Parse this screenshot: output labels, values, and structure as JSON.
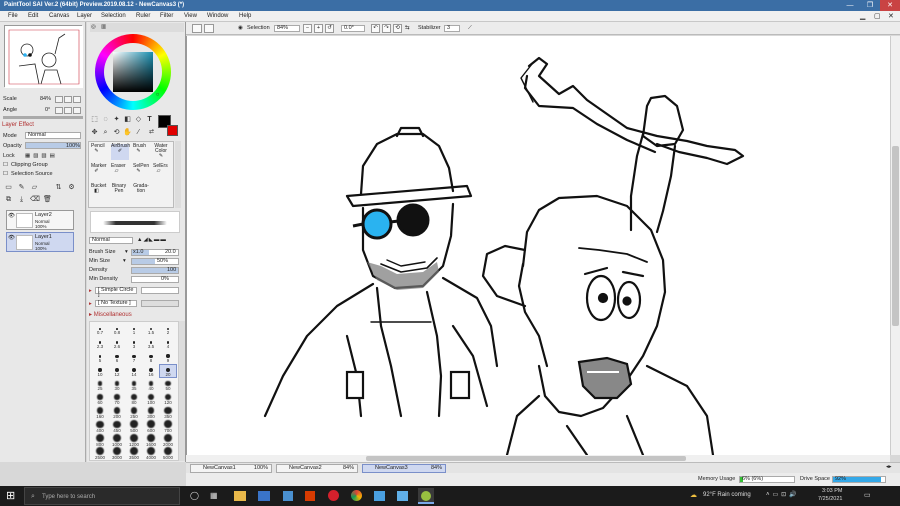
{
  "app": {
    "title": "PaintTool SAI Ver.2 (64bit) Preview.2019.08.12 - NewCanvas3 (*)",
    "minimize": "—",
    "maximize": "❐",
    "close": "✕"
  },
  "menu": [
    "File",
    "Edit",
    "Canvas",
    "Layer",
    "Selection",
    "Ruler",
    "Filter",
    "View",
    "Window",
    "Help"
  ],
  "toolbar": {
    "selection": "Selection",
    "zoom": "84%",
    "angle": "0.0°",
    "stabilizer_label": "Stabilizer",
    "stabilizer_value": "3"
  },
  "navigator": {
    "scale_label": "Scale",
    "scale_value": "84%",
    "angle_label": "Angle",
    "angle_value": "0°"
  },
  "layer_effect": {
    "title": "Layer Effect",
    "mode_label": "Mode",
    "mode_value": "Normal",
    "opacity_label": "Opacity",
    "opacity_value": "100%",
    "opacity_fraction": 1.0,
    "lock_label": "Lock",
    "clipping_group": "Clipping Group",
    "selection_source": "Selection Source"
  },
  "layers": [
    {
      "name": "Layer2",
      "mode": "Normal",
      "opacity": "100%",
      "selected": false
    },
    {
      "name": "Layer1",
      "mode": "Normal",
      "opacity": "100%",
      "selected": true
    }
  ],
  "brushes": [
    {
      "label": "Pencil"
    },
    {
      "label": "AirBrush"
    },
    {
      "label": "Brush"
    },
    {
      "label": "Water Color"
    },
    {
      "label": "Marker"
    },
    {
      "label": "Eraser"
    },
    {
      "label": "SelPen"
    },
    {
      "label": "SelErs"
    },
    {
      "label": "Bucket"
    },
    {
      "label": "Binary Pen"
    },
    {
      "label": "Grada-tion"
    }
  ],
  "brush_settings": {
    "blend_mode": "Normal",
    "size_label": "Brush Size",
    "size_multiplier": "x1.0",
    "size_value": "20.0",
    "min_size_label": "Min Size",
    "min_size_value": "50%",
    "min_size_fraction": 0.5,
    "density_label": "Density",
    "density_value": "100",
    "density_fraction": 1.0,
    "min_density_label": "Min Density",
    "min_density_value": "0%",
    "min_density_fraction": 0.0,
    "shape": "[ Simple Circle ]",
    "texture": "[ No Texture ]",
    "misc": "Miscellaneous"
  },
  "brush_sizes": [
    "0.7",
    "0.8",
    "1",
    "1.5",
    "2",
    "2.3",
    "2.6",
    "3",
    "3.5",
    "4",
    "5",
    "6",
    "7",
    "8",
    "9",
    "10",
    "12",
    "14",
    "16",
    "20",
    "25",
    "30",
    "35",
    "40",
    "50",
    "60",
    "70",
    "80",
    "100",
    "120",
    "160",
    "200",
    "250",
    "300",
    "350",
    "400",
    "450",
    "500",
    "600",
    "700",
    "800",
    "1000",
    "1200",
    "1600",
    "2000",
    "2500",
    "3000",
    "3500",
    "4000",
    "5000"
  ],
  "selected_brush_size": "20",
  "canvas_tabs": [
    {
      "name": "NewCanvas1",
      "zoom": "100%",
      "active": false
    },
    {
      "name": "NewCanvas2",
      "zoom": "84%",
      "active": false
    },
    {
      "name": "NewCanvas3",
      "zoom": "84%",
      "active": true
    }
  ],
  "status": {
    "memory_label": "Memory Usage",
    "memory_value": "6% (6%)",
    "memory_fraction": 0.06,
    "drive_label": "Drive Space",
    "drive_value": "92%",
    "drive_fraction": 0.92
  },
  "taskbar": {
    "search_placeholder": "Type here to search",
    "weather": "92°F  Rain coming",
    "time": "3:03 PM",
    "date": "7/25/2021"
  },
  "colors": {
    "accent": "#3b6ea5",
    "primary": "#000000",
    "secondary": "#e00000",
    "tab_active": "#cfd8f0"
  }
}
